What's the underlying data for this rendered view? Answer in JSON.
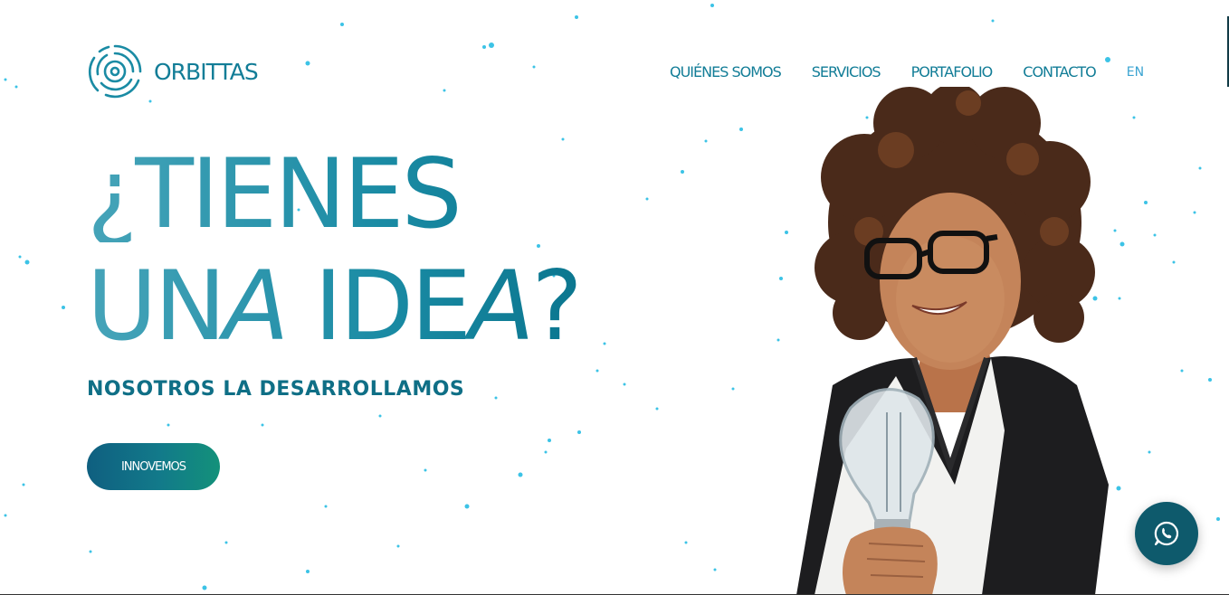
{
  "brand": {
    "name": "ORBITTAS",
    "icon": "orbit-logo-icon",
    "color": "#127d97"
  },
  "nav": {
    "items": [
      {
        "label": "QUIÉNES SOMOS"
      },
      {
        "label": "SERVICIOS"
      },
      {
        "label": "PORTAFOLIO"
      },
      {
        "label": "CONTACTO"
      }
    ],
    "language": "EN"
  },
  "hero": {
    "title_line1": "¿TIENES",
    "title_line2_part1": "UN",
    "title_line2_part2": "A",
    "title_line2_part3": " IDE",
    "title_line2_part4": "A",
    "title_line2_part5": "?",
    "subtitle": "NOSOTROS LA DESARROLLAMOS",
    "cta_label": "INNOVEMOS"
  },
  "image": {
    "description_icon": "woman-holding-lightbulb-photo"
  },
  "floating": {
    "icon": "whatsapp-icon"
  },
  "colors": {
    "accent": "#127d97",
    "title_gradient_start": "#46a4b9",
    "title_gradient_end": "#0b768f",
    "cta_start": "#0f5f80",
    "cta_end": "#13917a",
    "whatsapp_bg": "#0e5a6c",
    "particles": "#3cc3e6"
  }
}
